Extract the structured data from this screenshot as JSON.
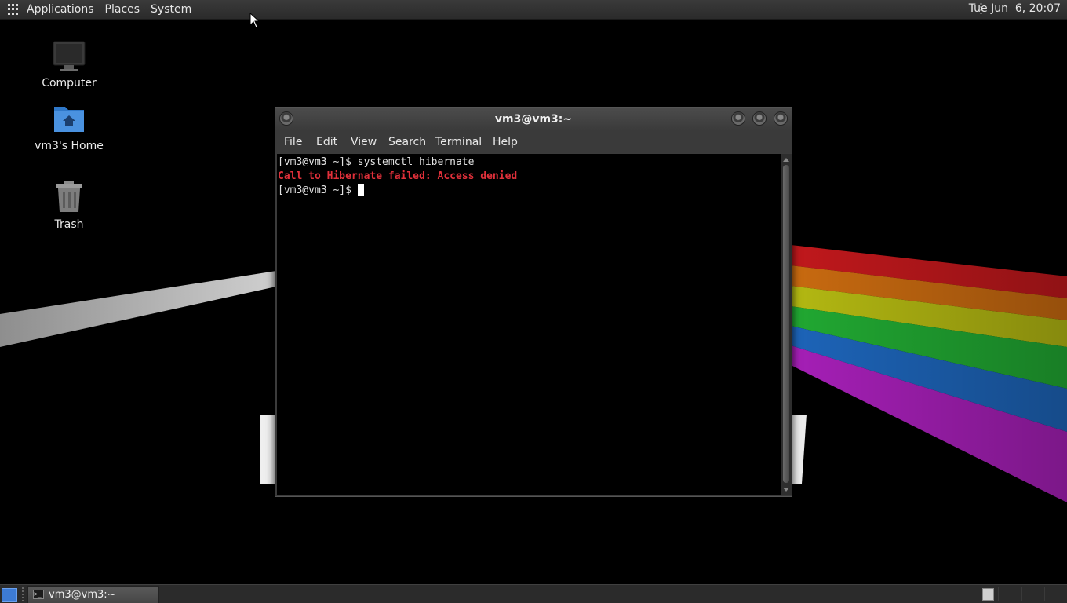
{
  "top_panel": {
    "menus": [
      "Applications",
      "Places",
      "System"
    ],
    "clock": "Tue Jun  6, 20:07"
  },
  "desktop_icons": [
    {
      "label": "Computer",
      "icon": "computer-icon"
    },
    {
      "label": "vm3's Home",
      "icon": "home-folder-icon"
    },
    {
      "label": "Trash",
      "icon": "trash-icon"
    }
  ],
  "terminal": {
    "title": "vm3@vm3:~",
    "menu": [
      "File",
      "Edit",
      "View",
      "Search",
      "Terminal",
      "Help"
    ],
    "lines": [
      {
        "text": "[vm3@vm3 ~]$ systemctl hibernate",
        "style": "normal"
      },
      {
        "text": "Call to Hibernate failed: Access denied",
        "style": "error"
      },
      {
        "text": "[vm3@vm3 ~]$ ",
        "style": "prompt"
      }
    ],
    "colors": {
      "background": "#000000",
      "text": "#e0e0e0",
      "error": "#e0303a"
    }
  },
  "taskbar": {
    "tasks": [
      {
        "label": "vm3@vm3:~",
        "icon": "terminal-icon"
      }
    ]
  }
}
